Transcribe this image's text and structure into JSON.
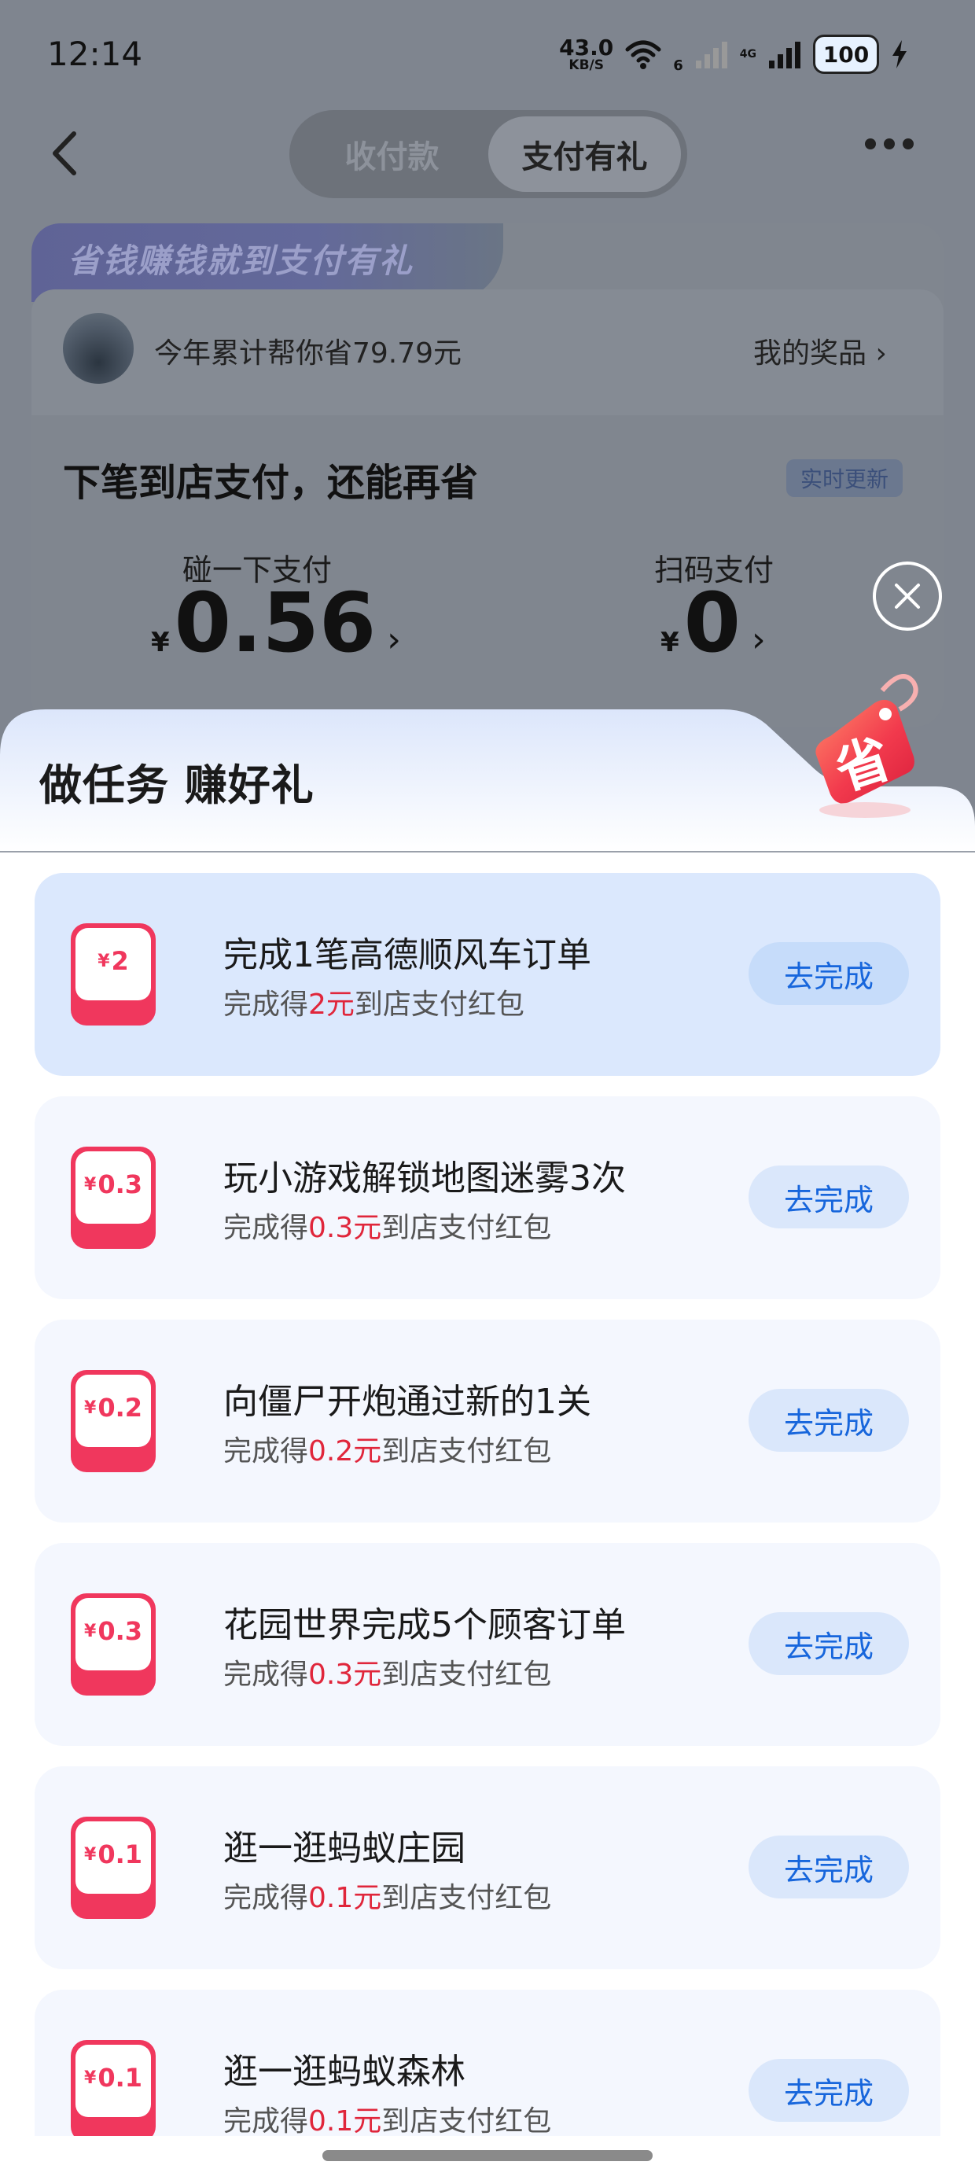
{
  "status_bar": {
    "time": "12:14",
    "net_speed": "43.0",
    "net_unit": "KB/S",
    "sim_slot": "6",
    "network": "4G",
    "battery": "100"
  },
  "header": {
    "tabs": [
      {
        "label": "收付款",
        "active": false
      },
      {
        "label": "支付有礼",
        "active": true
      }
    ]
  },
  "summary": {
    "banner": "省钱赚钱就到支付有礼",
    "saved_text": "今年累计帮你省79.79元",
    "my_prizes": "我的奖品 ›",
    "section_title": "下笔到店支付，还能再省",
    "realtime_tag": "实时更新",
    "pay_methods": [
      {
        "label": "碰一下支付",
        "currency": "¥",
        "amount": "0.56",
        "chevron": "›"
      },
      {
        "label": "扫码支付",
        "currency": "¥",
        "amount": "0",
        "chevron": "›"
      }
    ]
  },
  "sheet": {
    "title": "做任务 赚好礼",
    "badge_text": "省",
    "tasks": [
      {
        "reward": "2",
        "title": "完成1笔高德顺风车订单",
        "sub_prefix": "完成得",
        "sub_amount": "2元",
        "sub_suffix": "到店支付红包",
        "button": "去完成",
        "highlight": true
      },
      {
        "reward": "0.3",
        "title": "玩小游戏解锁地图迷雾3次",
        "sub_prefix": "完成得",
        "sub_amount": "0.3元",
        "sub_suffix": "到店支付红包",
        "button": "去完成"
      },
      {
        "reward": "0.2",
        "title": "向僵尸开炮通过新的1关",
        "sub_prefix": "完成得",
        "sub_amount": "0.2元",
        "sub_suffix": "到店支付红包",
        "button": "去完成"
      },
      {
        "reward": "0.3",
        "title": "花园世界完成5个顾客订单",
        "sub_prefix": "完成得",
        "sub_amount": "0.3元",
        "sub_suffix": "到店支付红包",
        "button": "去完成"
      },
      {
        "reward": "0.1",
        "title": "逛一逛蚂蚁庄园",
        "sub_prefix": "完成得",
        "sub_amount": "0.1元",
        "sub_suffix": "到店支付红包",
        "button": "去完成"
      },
      {
        "reward": "0.1",
        "title": "逛一逛蚂蚁森林",
        "sub_prefix": "完成得",
        "sub_amount": "0.1元",
        "sub_suffix": "到店支付红包",
        "button": "去完成"
      }
    ]
  },
  "colors": {
    "accent_blue": "#1766dc",
    "reward_red": "#e0263b",
    "envelope_pink": "#f0375d",
    "highlight_card": "#dbe8fd"
  }
}
